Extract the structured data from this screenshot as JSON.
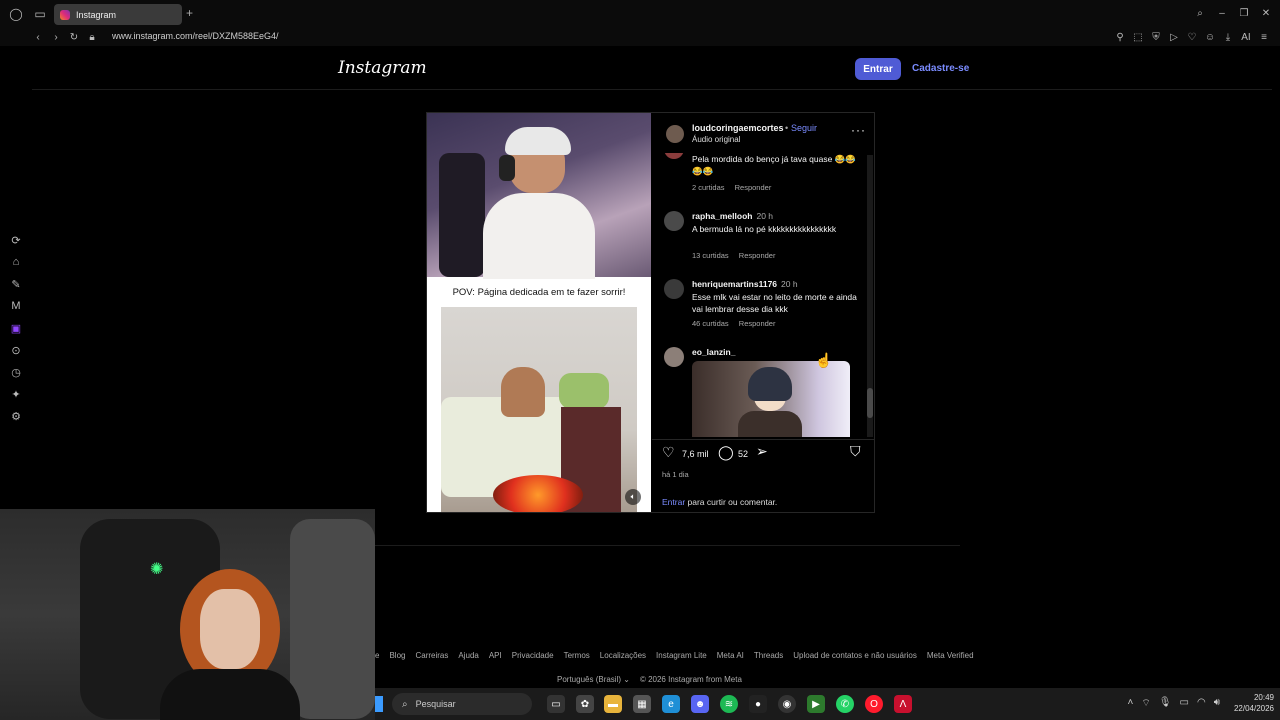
{
  "browser": {
    "tab_title": "Instagram",
    "url": "www.instagram.com/reel/DXZM588EeG4/",
    "new_tab": "+",
    "ai_label": "AI"
  },
  "header": {
    "logo": "Instagram",
    "login_button": "Entrar",
    "signup_link": "Cadastre-se"
  },
  "post": {
    "video_caption": "POV: Página dedicada em te fazer sorrir!",
    "author": "loudcoringaemcortes",
    "separator": "•",
    "follow": "Seguir",
    "audio": "Áudio original",
    "more": "···",
    "likes": "7,6 mil",
    "comments_count": "52",
    "posted_ago": "há 1 dia",
    "login_prompt_link": "Entrar",
    "login_prompt_text": " para curtir ou comentar."
  },
  "comments": [
    {
      "user": "",
      "time": "",
      "text": "Pela mordida do benço já tava quase 😂😂😂😂",
      "likes": "2 curtidas",
      "reply": "Responder"
    },
    {
      "user": "rapha_mellooh",
      "time": "20 h",
      "text": "A bermuda lá no pé kkkkkkkkkkkkkkkk",
      "likes": "13 curtidas",
      "reply": "Responder"
    },
    {
      "user": "henriquemartins1176",
      "time": "20 h",
      "text": "Esse mlk vai estar no leito de morte e ainda vai lembrar desse dia kkk",
      "likes": "46 curtidas",
      "reply": "Responder"
    },
    {
      "user": "eo_lanzin_",
      "time": "",
      "text": "",
      "likes": "",
      "reply": ""
    }
  ],
  "footer": {
    "links": [
      "e",
      "Blog",
      "Carreiras",
      "Ajuda",
      "API",
      "Privacidade",
      "Termos",
      "Localizações",
      "Instagram Lite",
      "Meta AI",
      "Threads",
      "Upload de contatos e não usuários",
      "Meta Verified"
    ],
    "language": "Português (Brasil)",
    "copyright": "© 2026 Instagram from Meta"
  },
  "taskbar": {
    "search_placeholder": "Pesquisar",
    "time": "20:49",
    "date": "22/04/2026"
  },
  "colors": {
    "accent": "#4f5bd5",
    "link": "#7b8cff",
    "background": "#000000"
  }
}
